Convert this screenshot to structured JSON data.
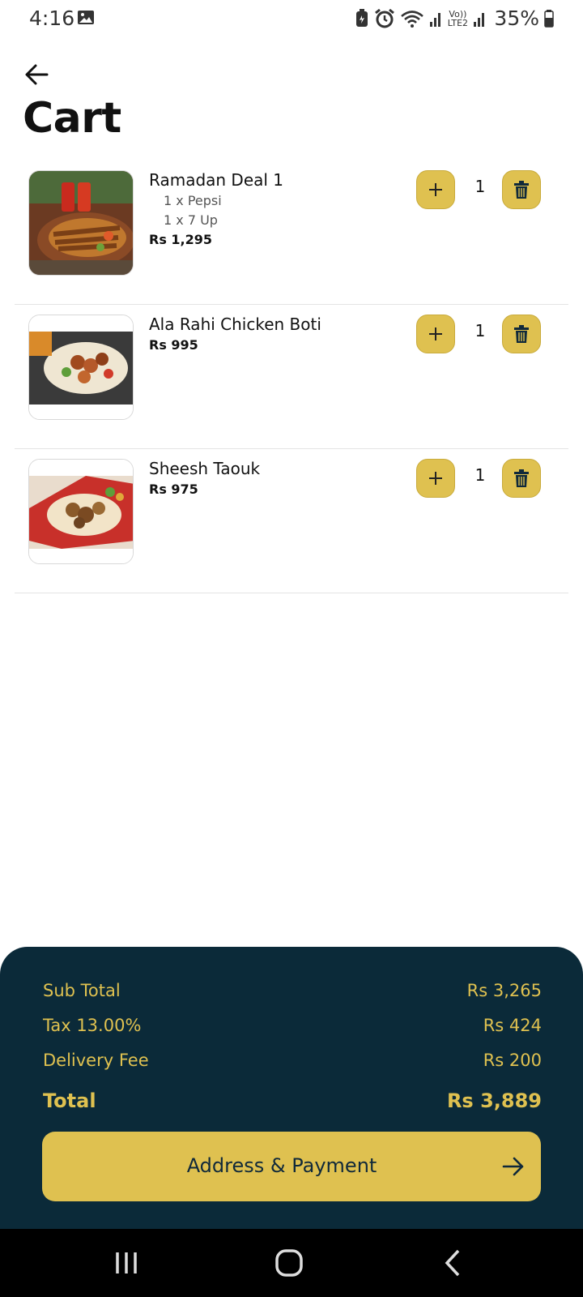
{
  "status_bar": {
    "time": "4:16",
    "battery": "35%",
    "network_label": "Vo)) LTE2"
  },
  "header": {
    "title": "Cart"
  },
  "items": [
    {
      "name": "Ramadan Deal 1",
      "addons": [
        "1 x Pepsi",
        "1 x 7 Up"
      ],
      "price": "Rs 1,295",
      "quantity": "1"
    },
    {
      "name": "Ala Rahi Chicken Boti",
      "addons": [],
      "price": "Rs 995",
      "quantity": "1"
    },
    {
      "name": "Sheesh Taouk",
      "addons": [],
      "price": "Rs 975",
      "quantity": "1"
    }
  ],
  "summary": {
    "subtotal_label": "Sub Total",
    "subtotal_value": "Rs 3,265",
    "tax_label": "Tax 13.00%",
    "tax_value": "Rs 424",
    "delivery_label": "Delivery Fee",
    "delivery_value": "Rs 200",
    "total_label": "Total",
    "total_value": "Rs 3,889"
  },
  "checkout": {
    "label": "Address & Payment"
  },
  "colors": {
    "accent": "#dfc150",
    "panel": "#0b2a39",
    "nav": "#000000"
  },
  "icons": {
    "back": "arrow-left-icon",
    "plus": "plus-icon",
    "trash": "trash-icon",
    "checkout_arrow": "arrow-right-icon",
    "nav_recents": "recents-icon",
    "nav_home": "home-icon",
    "nav_back": "back-chevron-icon"
  }
}
